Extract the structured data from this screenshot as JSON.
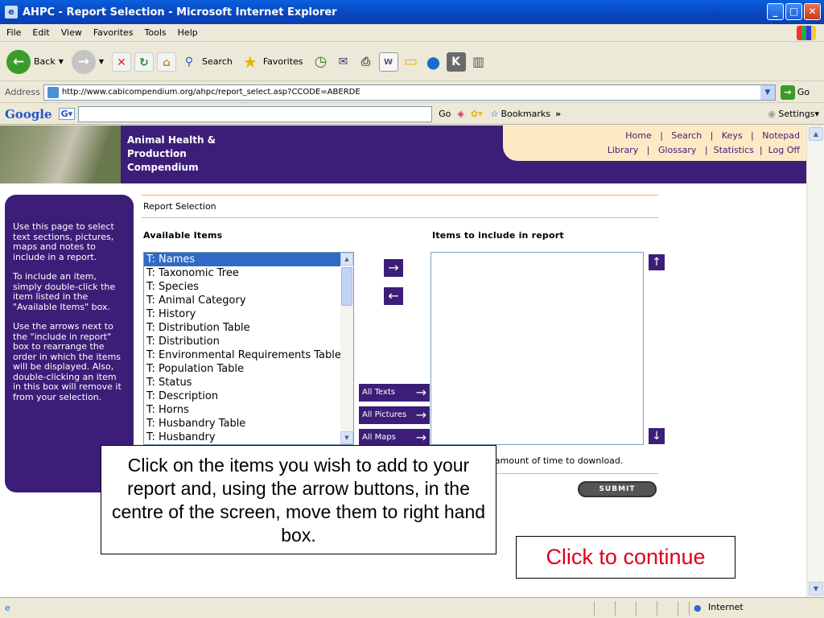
{
  "window": {
    "title": "AHPC - Report Selection - Microsoft Internet Explorer",
    "menu": [
      "File",
      "Edit",
      "View",
      "Favorites",
      "Tools",
      "Help"
    ]
  },
  "toolbar": {
    "back": "Back",
    "search": "Search",
    "favorites": "Favorites"
  },
  "address": {
    "label": "Address",
    "url": "http://www.cabicompendium.org/ahpc/report_select.asp?CCODE=ABERDE",
    "go": "Go"
  },
  "googlebar": {
    "logo": "Google",
    "go": "Go",
    "bookmarks": "Bookmarks",
    "more": "»",
    "settings": "Settings"
  },
  "site": {
    "title_lines": [
      "Animal Health &",
      "Production",
      "Compendium"
    ],
    "nav_row1": "Home   |   Search   |   Keys   |   Notepad",
    "nav_row2": "Library   |   Glossary   |  Statistics  |  Log Off"
  },
  "help_text": [
    "Use this page to select text sections, pictures, maps and notes to include in a report.",
    "To include an item, simply double-click the item listed in the \"Available Items\" box.",
    "Use the arrows next to the \"include in report\" box to rearrange the order in which the items will be displayed. Also, double-clicking an item in this box will remove it from your selection."
  ],
  "report": {
    "heading": "Report Selection",
    "available_label": "Available Items",
    "include_label": "Items to include in report",
    "available_items": [
      "T: Names",
      "T: Taxonomic Tree",
      "T: Species",
      "T: Animal Category",
      "T: History",
      "T: Distribution Table",
      "T: Distribution",
      "T: Environmental Requirements Table",
      "T: Population Table",
      "T: Status",
      "T: Description",
      "T: Horns",
      "T: Husbandry Table",
      "T: Husbandry"
    ],
    "selected_index": 0,
    "all_texts": "All Texts",
    "all_pictures": "All Pictures",
    "all_maps": "All Maps",
    "download_note": "nt amount of time to download.",
    "submit": "SUBMIT"
  },
  "status": {
    "zone": "Internet"
  },
  "overlay": {
    "instruction": "Click on the items you wish to add to your report and, using the arrow buttons, in the centre of the screen, move them to right hand box.",
    "continue": "Click to continue"
  },
  "colors": {
    "brand_purple": "#3c1e78",
    "nav_peach": "#fde9c4",
    "continue_red": "#e0001b"
  }
}
